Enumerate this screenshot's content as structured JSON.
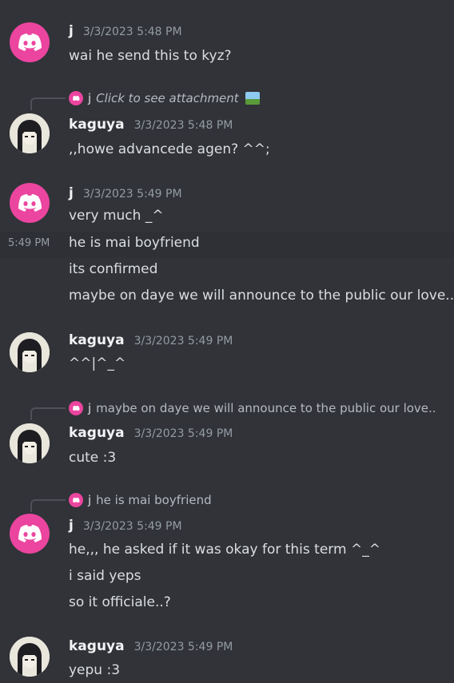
{
  "messages": [
    {
      "author": "j",
      "time": "3/3/2023 5:48 PM",
      "lines": [
        "wai he send this to kyz?"
      ]
    },
    {
      "reply": {
        "author": "j",
        "text": "Click to see attachment"
      },
      "author": "kaguya",
      "time": "3/3/2023 5:48 PM",
      "lines": [
        ",,howe advancede agen? ^^;"
      ]
    },
    {
      "author": "j",
      "time": "3/3/2023 5:49 PM",
      "lines": [
        "very much _^"
      ]
    },
    {
      "hover_time": "5:49 PM",
      "lines": [
        "he is mai boyfriend",
        "its confirmed",
        "maybe on daye we will announce to the public our love.."
      ]
    },
    {
      "author": "kaguya",
      "time": "3/3/2023 5:49 PM",
      "lines": [
        "^^|^_^"
      ]
    },
    {
      "reply": {
        "author": "j",
        "text": "maybe on daye we will announce to the public our love.."
      },
      "author": "kaguya",
      "time": "3/3/2023 5:49 PM",
      "lines": [
        "cute :3"
      ]
    },
    {
      "reply": {
        "author": "j",
        "text": "he is mai boyfriend"
      },
      "author": "j",
      "time": "3/3/2023 5:49 PM",
      "lines": [
        "he,,, he asked if it was okay for this term ^_^",
        "i said yeps",
        "so it officiale..?"
      ]
    },
    {
      "author": "kaguya",
      "time": "3/3/2023 5:49 PM",
      "lines": [
        "yepu :3"
      ]
    }
  ],
  "colors": {
    "background": "#313338",
    "discord_avatar": "#eb459f",
    "text": "#dbdee1",
    "muted": "#949ba4"
  }
}
